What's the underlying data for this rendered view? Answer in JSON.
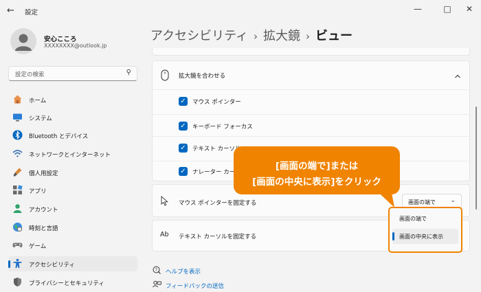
{
  "app": {
    "title": "設定"
  },
  "window": {
    "back_icon": "back-arrow-icon",
    "minimize": "minimize-icon",
    "maximize": "maximize-icon",
    "close": "close-icon"
  },
  "profile": {
    "name": "安心こころ",
    "email": "XXXXXXXX@outlook.jp"
  },
  "search": {
    "placeholder": "設定の検索"
  },
  "nav": {
    "items": [
      {
        "label": "ホーム",
        "icon": "home-icon"
      },
      {
        "label": "システム",
        "icon": "system-icon"
      },
      {
        "label": "Bluetooth とデバイス",
        "icon": "bluetooth-icon"
      },
      {
        "label": "ネットワークとインターネット",
        "icon": "wifi-icon"
      },
      {
        "label": "個人用設定",
        "icon": "brush-icon"
      },
      {
        "label": "アプリ",
        "icon": "apps-icon"
      },
      {
        "label": "アカウント",
        "icon": "account-icon"
      },
      {
        "label": "時刻と言語",
        "icon": "globe-icon"
      },
      {
        "label": "ゲーム",
        "icon": "gamepad-icon"
      },
      {
        "label": "アクセシビリティ",
        "icon": "accessibility-icon",
        "active": true
      },
      {
        "label": "プライバシーとセキュリティ",
        "icon": "shield-icon"
      }
    ]
  },
  "breadcrumb": {
    "item1": "アクセシビリティ",
    "item2": "拡大鏡",
    "current": "ビュー",
    "sep": "›"
  },
  "follow_section": {
    "label": "拡大鏡を合わせる",
    "icon": "mouse-icon",
    "expand_icon": "chevron-up-icon",
    "options": [
      {
        "label": "マウス ポインター",
        "checked": true
      },
      {
        "label": "キーボード フォーカス",
        "checked": true
      },
      {
        "label": "テキスト カーソル",
        "checked": true
      },
      {
        "label": "ナレーター カーソル",
        "checked": true
      }
    ]
  },
  "mouse_pointer_row": {
    "label": "マウス ポインターを固定する",
    "icon": "pointer-icon",
    "dropdown": {
      "selected": "画面の端で",
      "chevron": "chevron-down-icon"
    }
  },
  "dropdown_menu": {
    "options": [
      {
        "label": "画面の端で"
      },
      {
        "label": "画面の中央に表示",
        "selected": true
      }
    ]
  },
  "text_cursor_row": {
    "label": "テキスト カーソルを固定する",
    "icon_text": "Ab"
  },
  "callout": {
    "line1": "[画面の端で]または",
    "line2": "[画面の中央に表示]をクリック",
    "color": "#f08300"
  },
  "links": [
    {
      "label": "ヘルプを表示",
      "icon": "help-icon"
    },
    {
      "label": "フィードバックの送信",
      "icon": "feedback-icon"
    }
  ],
  "colors": {
    "accent": "#0067c0",
    "callout": "#f08300",
    "background": "#f3f3f3"
  }
}
